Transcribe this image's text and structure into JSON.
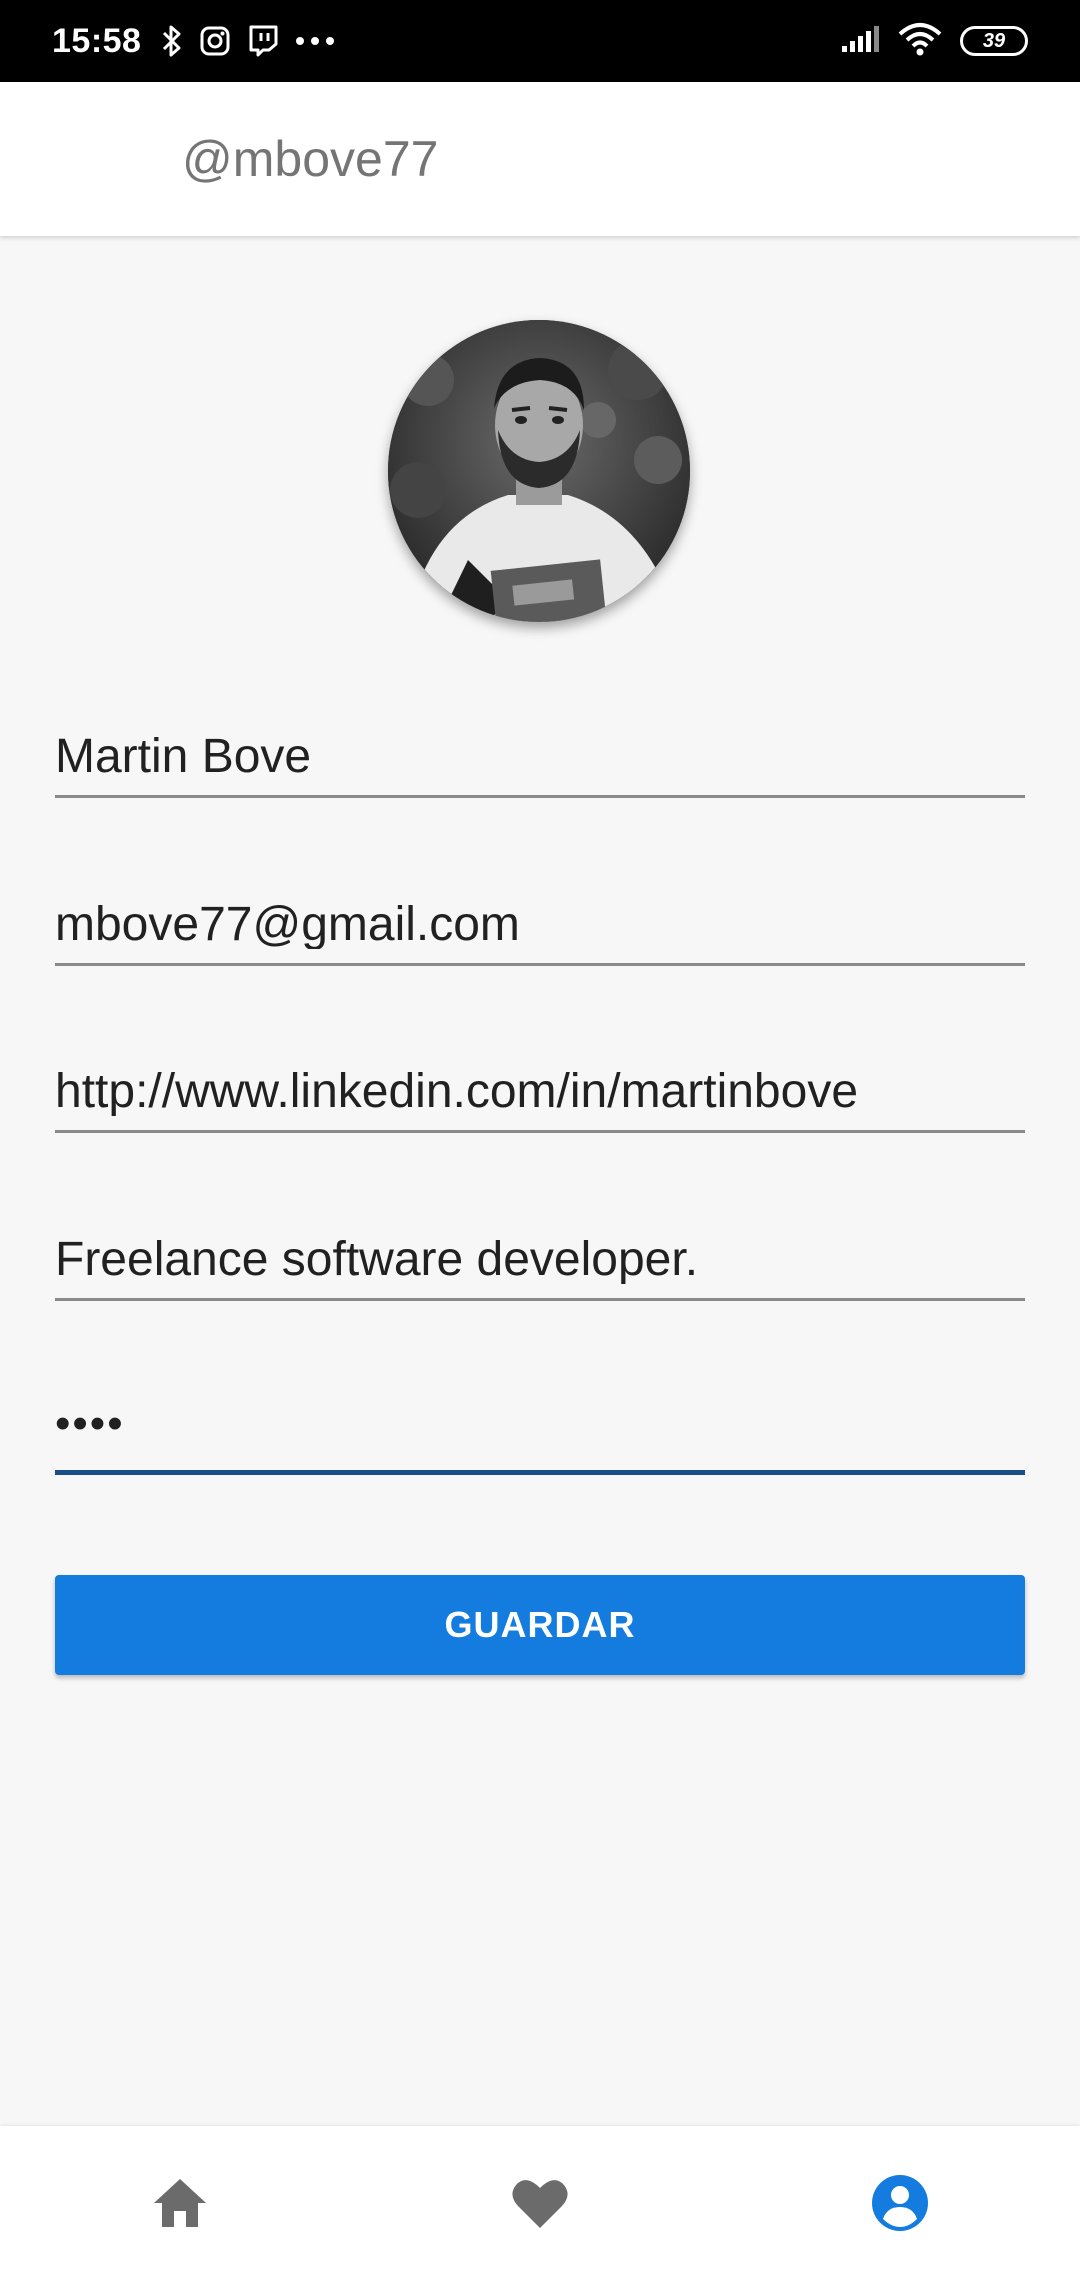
{
  "status_bar": {
    "time": "15:58",
    "battery": "39",
    "icons": [
      "bluetooth-icon",
      "instagram-icon",
      "twitch-icon",
      "more-icon",
      "signal-icon",
      "wifi-icon",
      "battery-icon"
    ]
  },
  "app_bar": {
    "title": "@mbove77"
  },
  "profile": {
    "avatar": "profile-photo"
  },
  "form": {
    "name": "Martin Bove",
    "email": "mbove77@gmail.com",
    "linkedin": "http://www.linkedin.com/in/martinbove",
    "bio": "Freelance software developer.",
    "password": "••••",
    "save_label": "GUARDAR"
  },
  "bottom_nav": {
    "items": [
      "home-icon",
      "heart-icon",
      "account-circle-icon"
    ],
    "active": "account-circle-icon",
    "active_color": "#137cde",
    "inactive_color": "#6b6b6b"
  },
  "colors": {
    "primary": "#137cde",
    "focused_underline": "#1a4f86"
  }
}
